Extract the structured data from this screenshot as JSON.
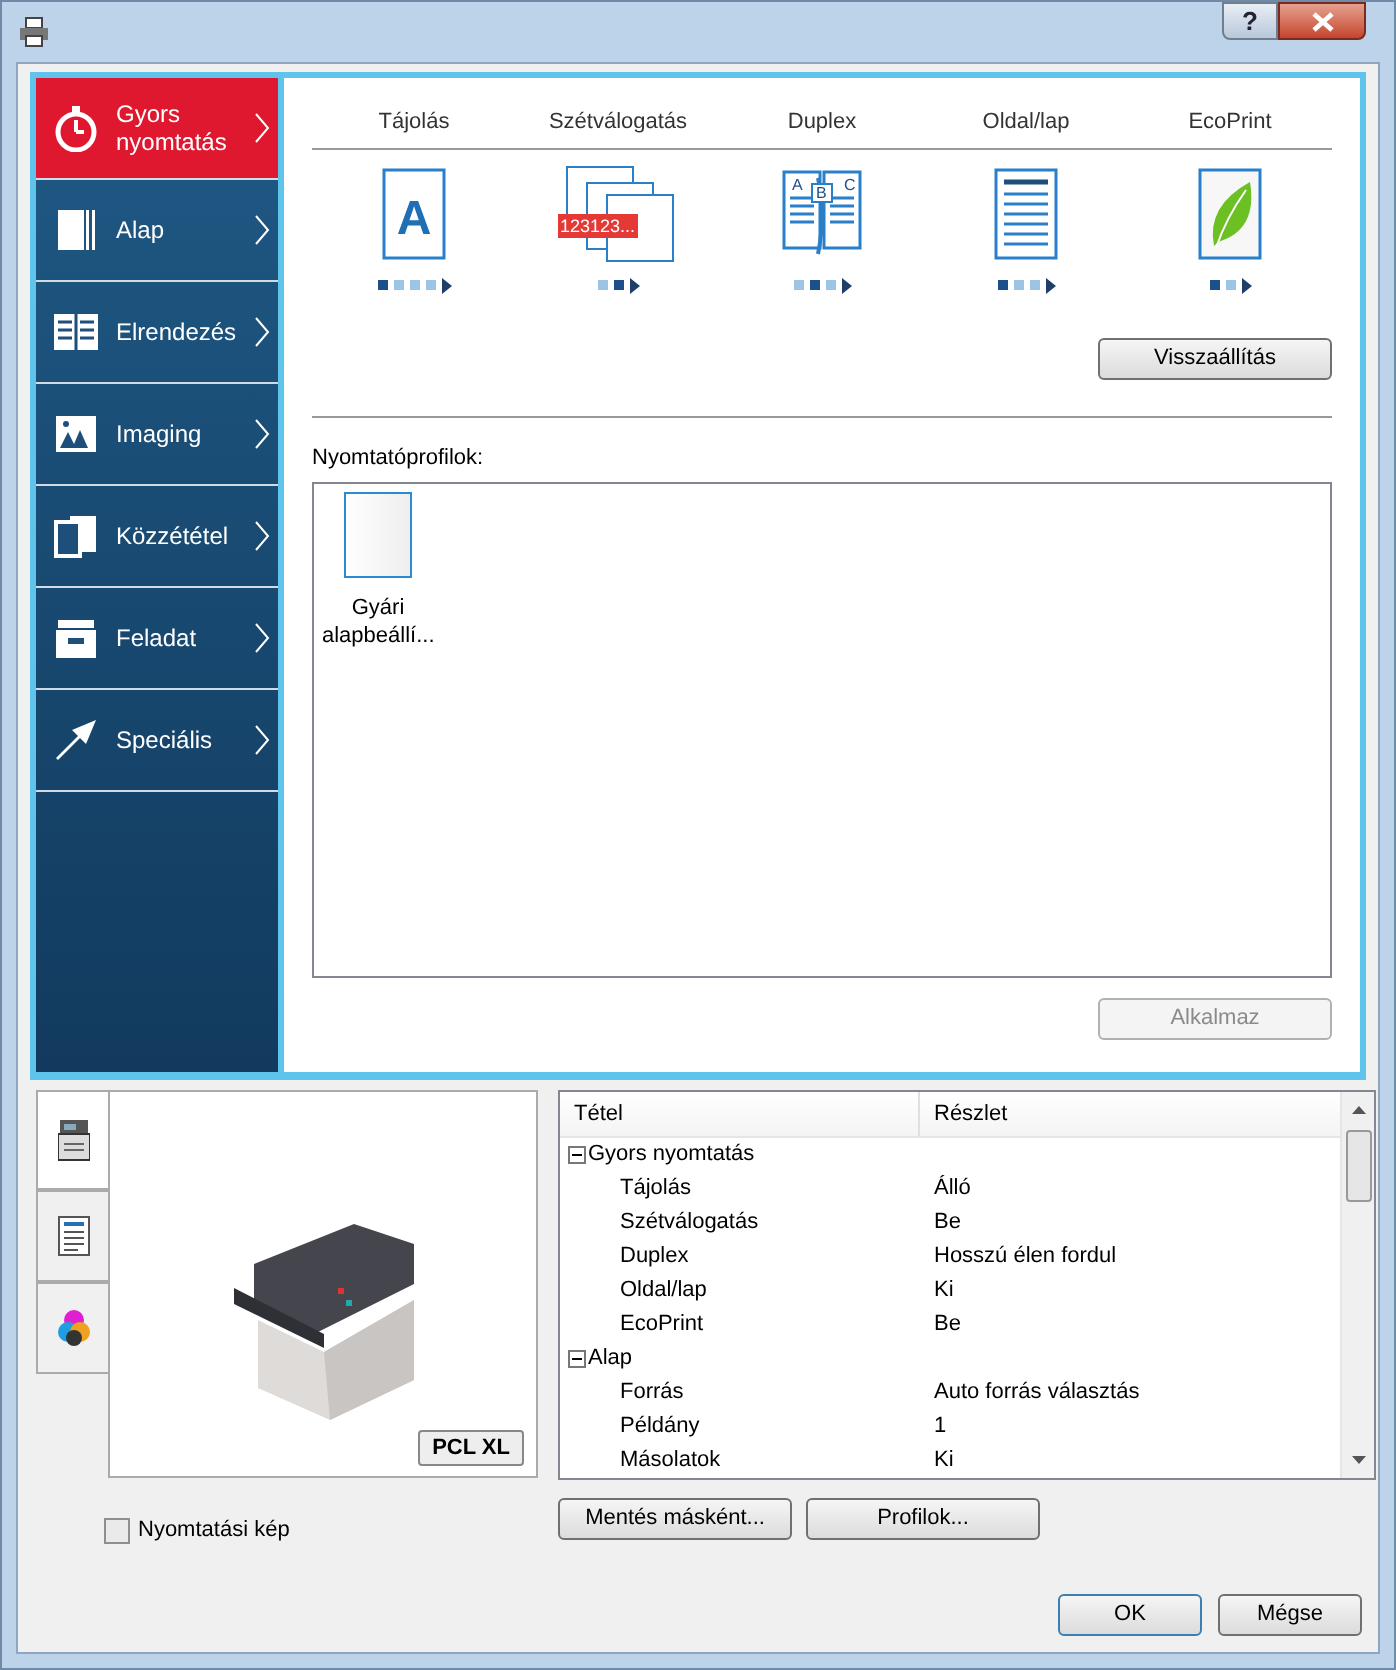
{
  "window": {
    "help": "?"
  },
  "sidebar": {
    "items": [
      {
        "label": "Gyors nyomtatás",
        "selected": true,
        "kind": "stopwatch"
      },
      {
        "label": "Alap",
        "selected": false,
        "kind": "page"
      },
      {
        "label": "Elrendezés",
        "selected": false,
        "kind": "layout"
      },
      {
        "label": "Imaging",
        "selected": false,
        "kind": "image"
      },
      {
        "label": "Közzététel",
        "selected": false,
        "kind": "publish"
      },
      {
        "label": "Feladat",
        "selected": false,
        "kind": "job"
      },
      {
        "label": "Speciális",
        "selected": false,
        "kind": "arrow"
      }
    ]
  },
  "quick_print": {
    "settings": [
      {
        "label": "Tájolás",
        "kind": "orientation",
        "icon_text": "A",
        "dots": [
          {
            "selected": true
          },
          {
            "selected": false
          },
          {
            "selected": false
          },
          {
            "selected": false
          }
        ]
      },
      {
        "label": "Szétválogatás",
        "kind": "collate",
        "icon_text": "123123...",
        "dots": [
          {
            "selected": false
          },
          {
            "selected": true
          }
        ]
      },
      {
        "label": "Duplex",
        "kind": "duplex",
        "icon_letters": [
          "A",
          "B",
          "C"
        ],
        "dots": [
          {
            "selected": false
          },
          {
            "selected": true
          },
          {
            "selected": false
          }
        ]
      },
      {
        "label": "Oldal/lap",
        "kind": "pages",
        "dots": [
          {
            "selected": true
          },
          {
            "selected": false
          },
          {
            "selected": false
          }
        ]
      },
      {
        "label": "EcoPrint",
        "kind": "eco",
        "dots": [
          {
            "selected": true
          },
          {
            "selected": false
          }
        ]
      }
    ],
    "reset_button": "Visszaállítás",
    "profiles_label": "Nyomtatóprofilok:",
    "profiles": [
      {
        "label": "Gyári alapbeállí...",
        "selected": false
      }
    ],
    "apply_button": {
      "label": "Alkalmaz",
      "disabled": true
    }
  },
  "preview": {
    "tabs": [
      {
        "kind": "printer",
        "selected": true
      },
      {
        "kind": "document",
        "selected": false
      },
      {
        "kind": "color",
        "selected": false
      }
    ],
    "badge": "PCL XL",
    "checkbox": {
      "label": "Nyomtatási kép",
      "checked": false
    }
  },
  "summary": {
    "columns": [
      "Tétel",
      "Részlet"
    ],
    "groups": [
      {
        "name": "Gyors nyomtatás",
        "expanded": true,
        "children": [
          {
            "name": "Tájolás",
            "value": "Álló"
          },
          {
            "name": "Szétválogatás",
            "value": "Be"
          },
          {
            "name": "Duplex",
            "value": "Hosszú élen fordul"
          },
          {
            "name": "Oldal/lap",
            "value": "Ki"
          },
          {
            "name": "EcoPrint",
            "value": "Be"
          }
        ]
      },
      {
        "name": "Alap",
        "expanded": true,
        "children": [
          {
            "name": "Forrás",
            "value": "Auto forrás választás"
          },
          {
            "name": "Példány",
            "value": "1"
          },
          {
            "name": "Másolatok",
            "value": "Ki"
          }
        ]
      }
    ]
  },
  "bottom_buttons": [
    "Mentés másként...",
    "Profilok..."
  ],
  "dialog_buttons": [
    "OK",
    "Mégse"
  ]
}
